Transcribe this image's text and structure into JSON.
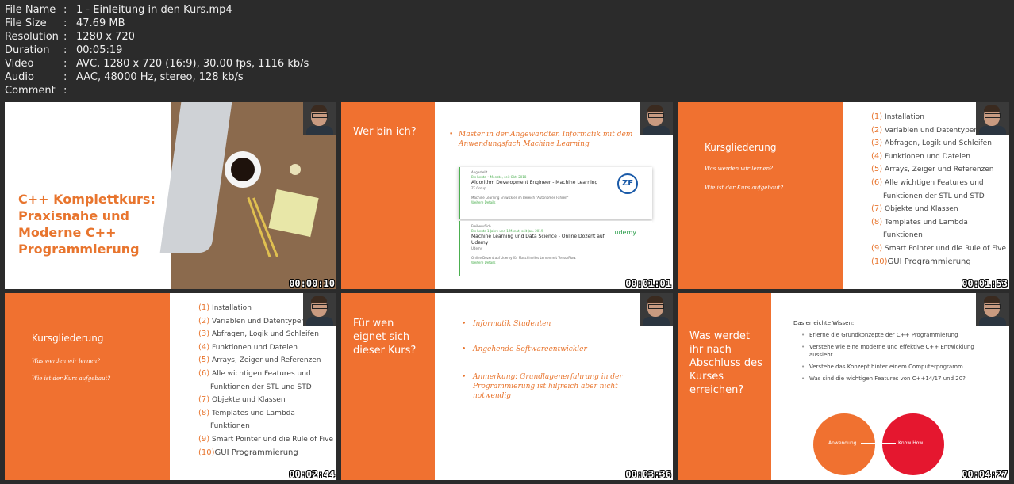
{
  "file_info": [
    {
      "key": "File Name",
      "value": "1 - Einleitung in den Kurs.mp4"
    },
    {
      "key": "File Size",
      "value": "47.69 MB"
    },
    {
      "key": "Resolution",
      "value": "1280 x 720"
    },
    {
      "key": "Duration",
      "value": "00:05:19"
    },
    {
      "key": "Video",
      "value": "AVC, 1280 x 720 (16:9), 30.00 fps, 1116 kb/s"
    },
    {
      "key": "Audio",
      "value": "AAC, 48000 Hz, stereo, 128 kb/s"
    },
    {
      "key": "Comment",
      "value": ""
    }
  ],
  "colon": ":",
  "thumbs": {
    "t1": {
      "title": "C++ Komplettkurs: Praxisnahe und Moderne C++ Programmierung",
      "time": "00:00:10"
    },
    "t2": {
      "title": "Wer bin ich?",
      "bullet": "Master in der Angewandten Informatik mit dem Anwendungsfach Machine Learning",
      "job1": {
        "small": "Angestellt",
        "date": "Bis heute • Monate, seit Okt. 2018",
        "title": "Algorithm Development Engineer - Machine Learning",
        "org": "ZF Group",
        "desc": "Machine Learning Entwickler im Bereich \"Autonomes Fahren\"",
        "more": "Weitere Details",
        "logo": "ZF"
      },
      "job2": {
        "small": "Freiberuflich",
        "date": "Bis heute 1 Jahre und 1 Monat, seit Jan. 2019",
        "title": "Machine Learning und Data Science - Online Dozent auf Udemy",
        "org": "Udemy",
        "desc": "Online Dozent auf Udemy für Maschinelles Lernen mit TensorFlow.",
        "more": "Weitere Details",
        "logo": "udemy"
      },
      "time": "00:01:01"
    },
    "t3": {
      "title": "Kursgliederung",
      "q1": "Was werden wir lernen?",
      "q2": "Wie ist der Kurs aufgebaut?",
      "time": "00:01:53"
    },
    "t4": {
      "title": "Kursgliederung",
      "q1": "Was werden wir lernen?",
      "q2": "Wie ist der Kurs aufgebaut?",
      "time": "00:02:44"
    },
    "t5": {
      "title": "Für wen eignet sich dieser Kurs?",
      "b1": "Informatik Studenten",
      "b2": "Angehende Softwareentwickler",
      "b3": "Anmerkung: Grundlagenerfahrung in der Programmierung ist hilfreich aber nicht notwendig",
      "time": "00:03:36"
    },
    "t6": {
      "title": "Was werdet ihr nach Abschluss des Kurses erreichen?",
      "intro": "Das erreichte Wissen:",
      "items": [
        "Erlerne die Grundkonzepte der C++ Programmierung",
        "Verstehe wie eine moderne und effektive C++ Entwicklung aussieht",
        "Verstehe das Konzept hinter einem Computerpogramm",
        "Was sind die wichtigen Features von C++14/17 und 20?"
      ],
      "c1": "Anwendung",
      "c2": "Know How",
      "time": "00:04:27"
    }
  },
  "outline": [
    {
      "n": "(1)",
      "t": "Installation"
    },
    {
      "n": "(2)",
      "t": "Variablen und Datentypen"
    },
    {
      "n": "(3)",
      "t": "Abfragen, Logik und Schleifen"
    },
    {
      "n": "(4)",
      "t": "Funktionen und Dateien"
    },
    {
      "n": "(5)",
      "t": "Arrays, Zeiger und Referenzen"
    },
    {
      "n": "(6)",
      "t": "Alle wichtigen Features und"
    },
    {
      "n": "",
      "t": "Funktionen der STL und STD"
    },
    {
      "n": "(7)",
      "t": "Objekte und Klassen"
    },
    {
      "n": "(8)",
      "t": "Templates und Lambda"
    },
    {
      "n": "",
      "t": "Funktionen"
    },
    {
      "n": "(9)",
      "t": "Smart Pointer und die Rule of Five"
    },
    {
      "n": "(10)",
      "t": "GUI Programmierung"
    }
  ],
  "colors": {
    "accent": "#f07130",
    "bg": "#2b2b2b",
    "circle2": "#e5172f"
  }
}
